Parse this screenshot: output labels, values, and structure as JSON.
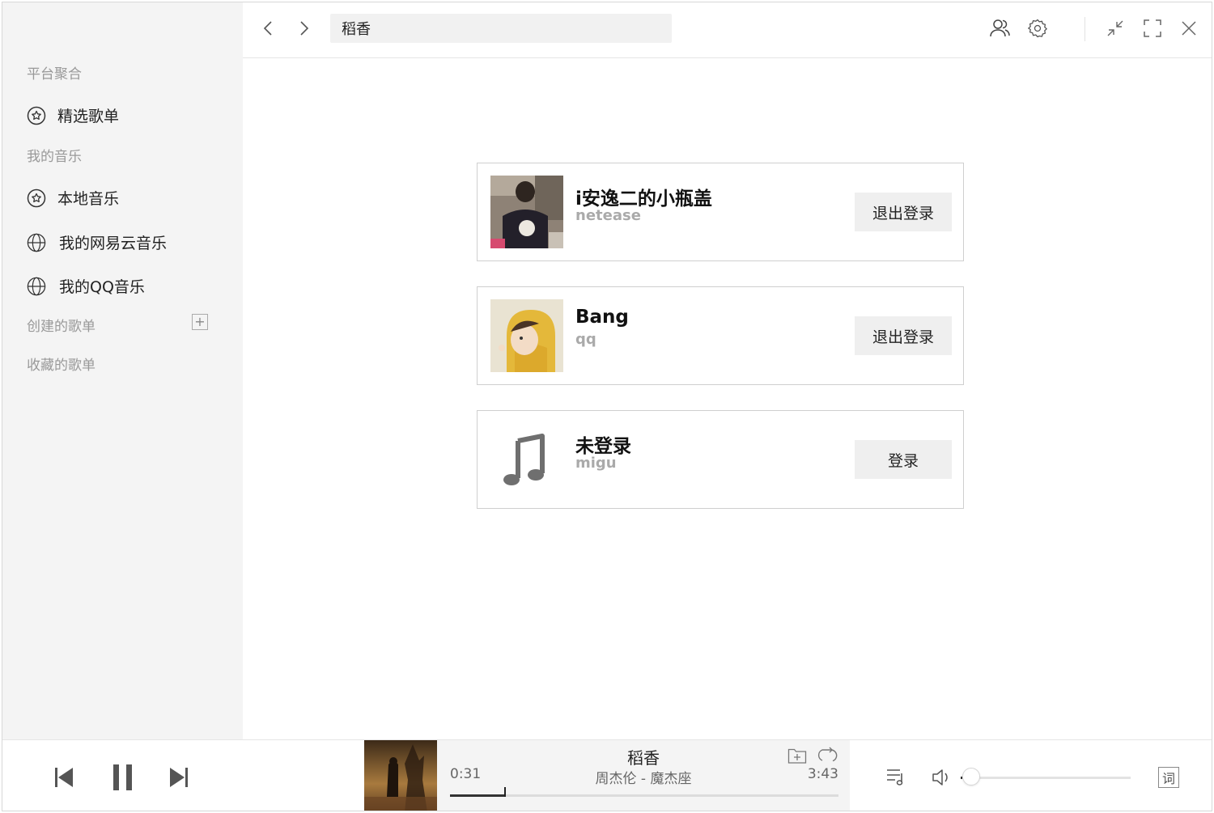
{
  "sidebar": {
    "platform_label": "平台聚合",
    "featured_label": "精选歌单",
    "my_music_label": "我的音乐",
    "local_music_label": "本地音乐",
    "netease_label": "我的网易云音乐",
    "qq_label": "我的QQ音乐",
    "created_label": "创建的歌单",
    "add_symbol": "+",
    "collected_label": "收藏的歌单"
  },
  "header": {
    "search_value": "稻香"
  },
  "accounts": [
    {
      "name": "i安逸二的小瓶盖",
      "platform": "netease",
      "button": "退出登录"
    },
    {
      "name": "Bang",
      "platform": "qq",
      "button": "退出登录"
    },
    {
      "name": "未登录",
      "platform": "migu",
      "button": "登录"
    }
  ],
  "player": {
    "title": "稻香",
    "artist": "周杰伦 - 魔杰座",
    "current_time": "0:31",
    "duration": "3:43",
    "progress": 0.14,
    "volume": 0.01,
    "lyric_label": "词"
  },
  "icons": {
    "back": "chevron-left-icon",
    "forward": "chevron-right-icon",
    "user": "users-icon",
    "settings": "gear-icon",
    "minimize": "minimize-icon",
    "maximize": "maximize-icon",
    "close": "close-icon"
  }
}
